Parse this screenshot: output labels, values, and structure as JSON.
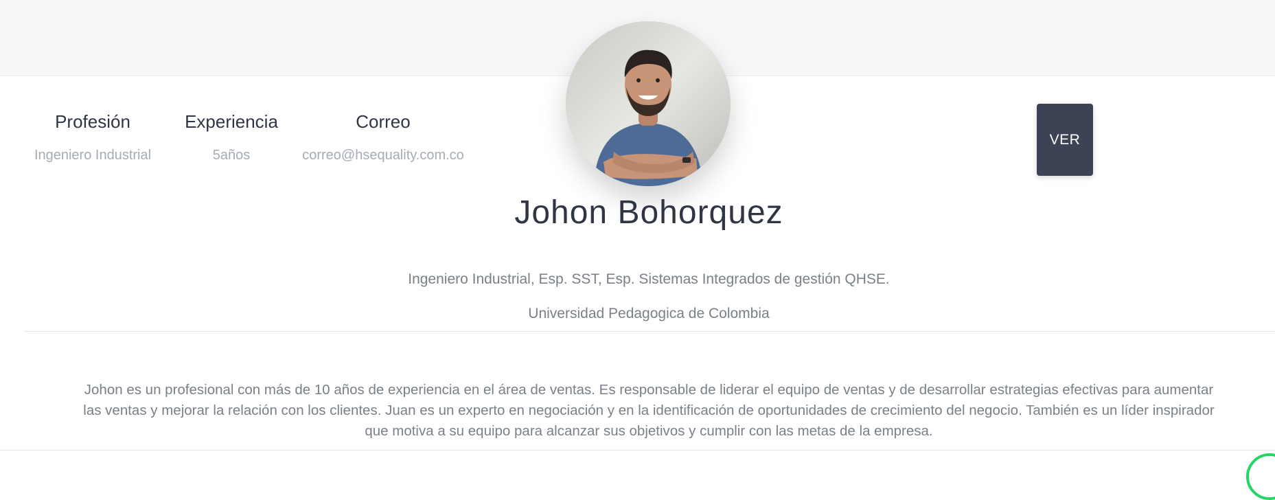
{
  "stats": {
    "profesion": {
      "label": "Profesión",
      "value": "Ingeniero Industrial"
    },
    "experiencia": {
      "label": "Experiencia",
      "value": "5años"
    },
    "correo": {
      "label": "Correo",
      "value": "correo@hsequality.com.co"
    }
  },
  "actions": {
    "ver_label": "VER"
  },
  "profile": {
    "name": "Johon Bohorquez",
    "degree": "Ingeniero Industrial, Esp. SST, Esp. Sistemas Integrados de gestión QHSE.",
    "university": "Universidad Pedagogica de Colombia",
    "bio": "Johon es un profesional con más de 10 años de experiencia en el área de ventas. Es responsable de liderar el equipo de ventas y de desarrollar estrategias efectivas para aumentar las ventas y mejorar la relación con los clientes. Juan es un experto en negociación y en la identificación de oportunidades de crecimiento del negocio. También es un líder inspirador que motiva a su equipo para alcanzar sus objetivos y cumplir con las metas de la empresa."
  },
  "icons": {
    "chat": "whatsapp-icon"
  },
  "colors": {
    "button_bg": "#3b4354",
    "chat_accent": "#25d366",
    "muted_text": "#a6acb4"
  }
}
